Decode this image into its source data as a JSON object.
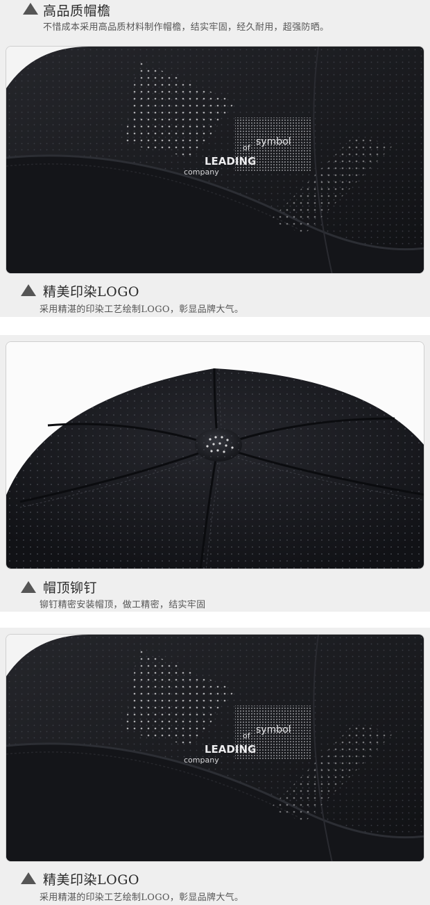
{
  "sections": [
    {
      "title": "高品质帽檐",
      "desc": "不惜成本采用高品质材料制作帽檐，结实牢固，经久耐用，超强防晒。"
    },
    {
      "title": "精美印染LOGO",
      "desc": "采用精湛的印染工艺绘制LOGO，彰显品牌大气。",
      "logo": {
        "line1": "symbol",
        "line2": "of",
        "line3": "LEADING",
        "line4": "company"
      }
    },
    {
      "title": "帽顶铆钉",
      "desc": "铆钉精密安装帽顶，做工精密，结实牢固"
    },
    {
      "title": "精美印染LOGO",
      "desc": "采用精湛的印染工艺绘制LOGO，彰显品牌大气。",
      "logo": {
        "line1": "symbol",
        "line2": "of",
        "line3": "LEADING",
        "line4": "company"
      }
    }
  ],
  "colors": {
    "band": "#efefef",
    "fabric": "#1b1c20",
    "fabric_dark": "#0e0f12",
    "icon": "#555555"
  },
  "icons": [
    "triangle-up-icon"
  ]
}
